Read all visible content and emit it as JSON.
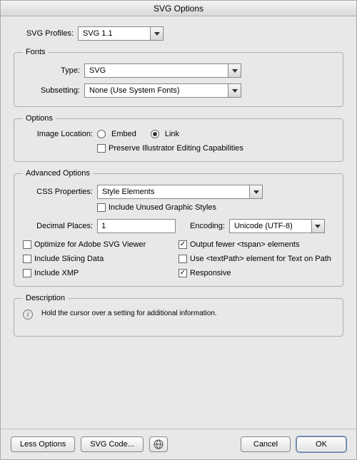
{
  "title": "SVG Options",
  "profiles": {
    "label": "SVG Profiles:",
    "value": "SVG 1.1"
  },
  "fonts": {
    "legend": "Fonts",
    "type": {
      "label": "Type:",
      "value": "SVG"
    },
    "subsetting": {
      "label": "Subsetting:",
      "value": "None (Use System Fonts)"
    }
  },
  "options": {
    "legend": "Options",
    "image_location_label": "Image Location:",
    "embed": "Embed",
    "link": "Link",
    "preserve": "Preserve Illustrator Editing Capabilities"
  },
  "advanced": {
    "legend": "Advanced Options",
    "css": {
      "label": "CSS Properties:",
      "value": "Style Elements"
    },
    "include_unused": "Include Unused Graphic Styles",
    "decimal": {
      "label": "Decimal Places:",
      "value": "1"
    },
    "encoding": {
      "label": "Encoding:",
      "value": "Unicode (UTF-8)"
    },
    "checks": {
      "optimize": "Optimize for Adobe SVG Viewer",
      "tspan": "Output fewer <tspan> elements",
      "slicing": "Include Slicing Data",
      "textpath": "Use <textPath> element for Text on Path",
      "xmp": "Include XMP",
      "responsive": "Responsive"
    }
  },
  "description": {
    "legend": "Description",
    "text": "Hold the cursor over a setting for additional information."
  },
  "footer": {
    "less": "Less Options",
    "svgcode": "SVG Code...",
    "cancel": "Cancel",
    "ok": "OK"
  }
}
